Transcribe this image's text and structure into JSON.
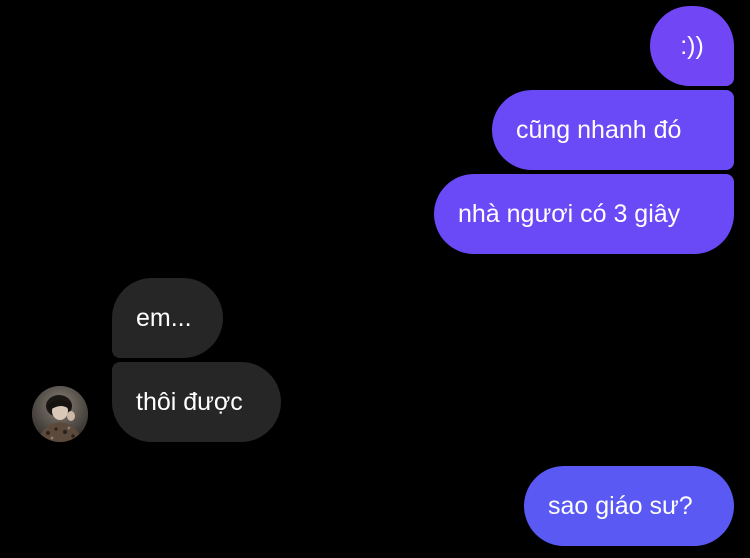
{
  "colors": {
    "background": "#000000",
    "outgoing_top": "#7146f5",
    "outgoing_mid": "#6a49f6",
    "outgoing_bottom": "#5a59f4",
    "incoming": "#262626",
    "text": "#ffffff"
  },
  "messages": [
    {
      "sender": "me",
      "text": ":))"
    },
    {
      "sender": "me",
      "text": "cũng nhanh đó"
    },
    {
      "sender": "me",
      "text": "nhà ngươi có 3 giây"
    },
    {
      "sender": "them",
      "text": "em..."
    },
    {
      "sender": "them",
      "text": "thôi được"
    },
    {
      "sender": "me",
      "text": "sao giáo sư?"
    }
  ],
  "contact": {
    "avatar_icon": "contact-avatar-photo"
  }
}
